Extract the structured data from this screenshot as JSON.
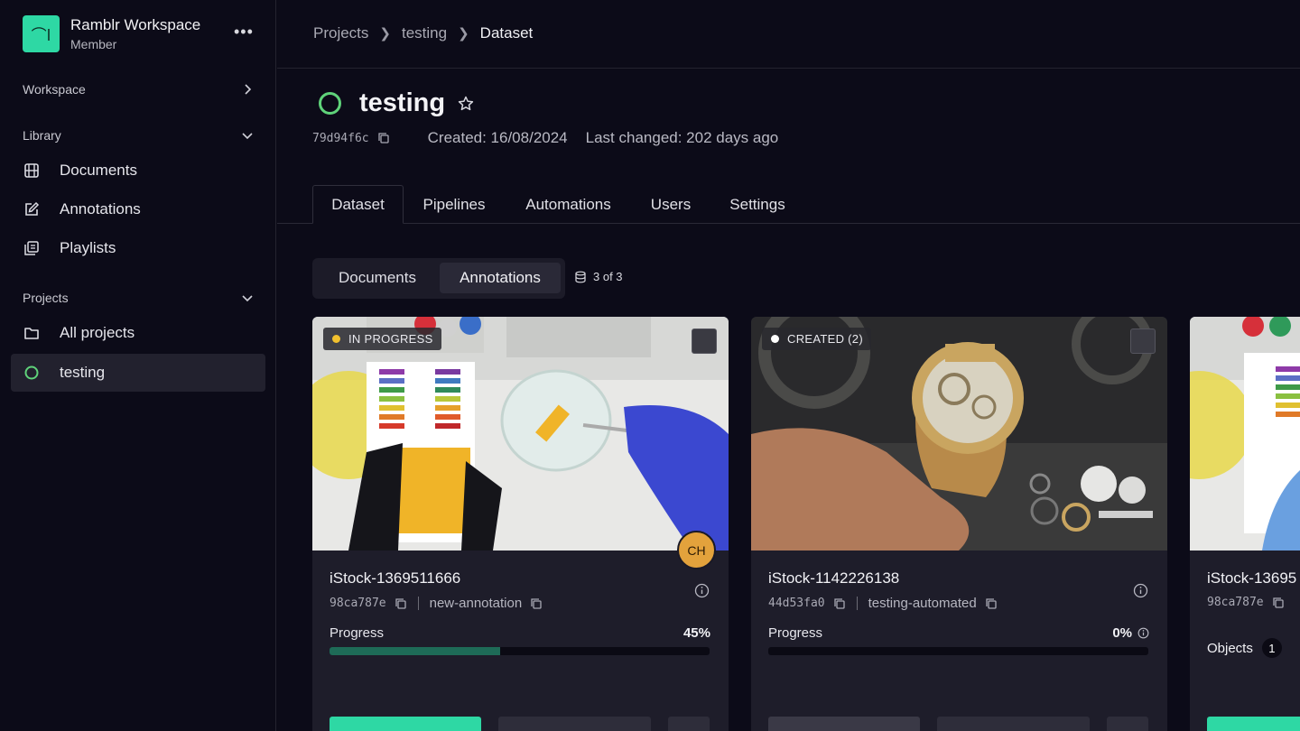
{
  "workspace": {
    "logo_text": "⌒l",
    "name": "Ramblr Workspace",
    "role": "Member"
  },
  "sidebar": {
    "workspace_label": "Workspace",
    "library_label": "Library",
    "library_items": [
      {
        "label": "Documents",
        "icon": "film-icon"
      },
      {
        "label": "Annotations",
        "icon": "edit-icon"
      },
      {
        "label": "Playlists",
        "icon": "playlist-icon"
      }
    ],
    "projects_label": "Projects",
    "project_items": [
      {
        "label": "All projects",
        "icon": "folder-icon"
      },
      {
        "label": "testing",
        "icon": "status-ring-icon",
        "active": true
      }
    ]
  },
  "breadcrumb": [
    "Projects",
    "testing",
    "Dataset"
  ],
  "page": {
    "title": "testing",
    "id": "79d94f6c",
    "created": "Created: 16/08/2024",
    "last_changed": "Last changed: 202 days ago",
    "status_color": "#5fd37a"
  },
  "tabs": [
    "Dataset",
    "Pipelines",
    "Automations",
    "Users",
    "Settings"
  ],
  "active_tab": "Dataset",
  "segment": {
    "documents": "Documents",
    "annotations": "Annotations",
    "active": "Annotations"
  },
  "count_label": "3 of 3",
  "cards": [
    {
      "status": "IN PROGRESS",
      "status_color": "#f2c12e",
      "title": "iStock-1369511666",
      "hash": "98ca787e",
      "pipeline": "new-annotation",
      "progress_label": "Progress",
      "progress_text": "45%",
      "progress": 0.45,
      "avatar": "CH"
    },
    {
      "status": "CREATED (2)",
      "status_color": "#ffffff",
      "title": "iStock-1142226138",
      "hash": "44d53fa0",
      "pipeline": "testing-automated",
      "progress_label": "Progress",
      "progress_text": "0%",
      "progress": 0
    },
    {
      "title": "iStock-13695",
      "hash": "98ca787e",
      "objects_label": "Objects",
      "objects_count": "1"
    }
  ],
  "colors": {
    "accent": "#2ed8a4",
    "background": "#0c0b18",
    "card": "#1e1d2a"
  }
}
